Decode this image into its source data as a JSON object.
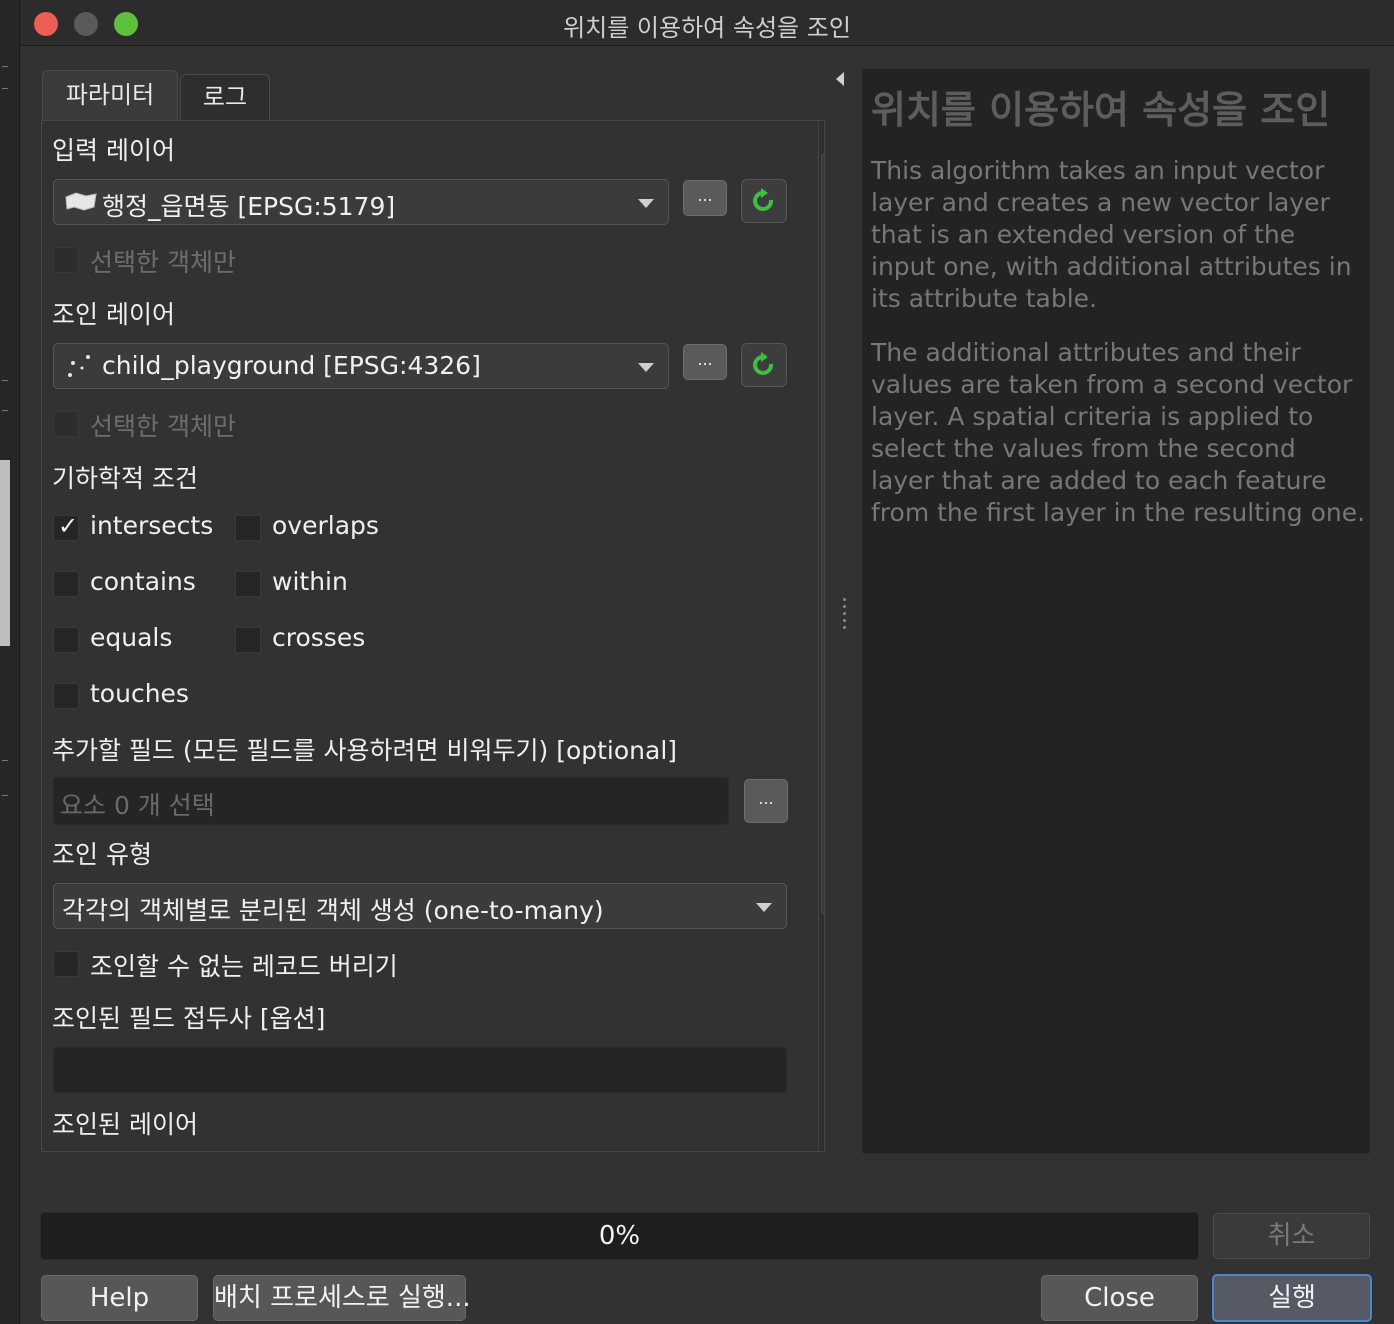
{
  "window": {
    "title": "위치를 이용하여 속성을 조인"
  },
  "tabs": [
    {
      "label": "파라미터"
    },
    {
      "label": "로그"
    }
  ],
  "params": {
    "input_layer": {
      "label": "입력 레이어",
      "value": "행정_읍면동 [EPSG:5179]",
      "selected_only": "선택한 객체만"
    },
    "join_layer": {
      "label": "조인 레이어",
      "value": "child_playground [EPSG:4326]",
      "selected_only": "선택한 객체만"
    },
    "browse": "...",
    "predicates": {
      "label": "기하학적 조건",
      "items": [
        {
          "label": "intersects",
          "checked": true
        },
        {
          "label": "overlaps",
          "checked": false
        },
        {
          "label": "contains",
          "checked": false
        },
        {
          "label": "within",
          "checked": false
        },
        {
          "label": "equals",
          "checked": false
        },
        {
          "label": "crosses",
          "checked": false
        },
        {
          "label": "touches",
          "checked": false
        }
      ],
      "check_glyph": "✓"
    },
    "fields": {
      "label": "추가할 필드 (모든 필드를 사용하려면 비워두기) [optional]",
      "placeholder": "요소 0 개 선택"
    },
    "join_type": {
      "label": "조인 유형",
      "value": "각각의 객체별로 분리된 객체 생성 (one-to-many)"
    },
    "discard": {
      "label": "조인할 수 없는 레코드 버리기"
    },
    "prefix": {
      "label": "조인된 필드 접두사 [옵션]",
      "value": ""
    },
    "joined_layer": {
      "label": "조인된 레이어"
    }
  },
  "help": {
    "title": "위치를 이용하여 속성을 조인",
    "p1": "This algorithm takes an input vector layer and creates a new vector layer that is an extended version of the input one, with additional attributes in its attribute table.",
    "p2": "The additional attributes and their values are taken from a second vector layer. A spatial criteria is applied to select the values from the second layer that are added to each feature from the first layer in the resulting one."
  },
  "progress": {
    "text": "0%"
  },
  "buttons": {
    "cancel": "취소",
    "help": "Help",
    "batch": "배치 프로세스로 실행...",
    "close": "Close",
    "run": "실행"
  }
}
